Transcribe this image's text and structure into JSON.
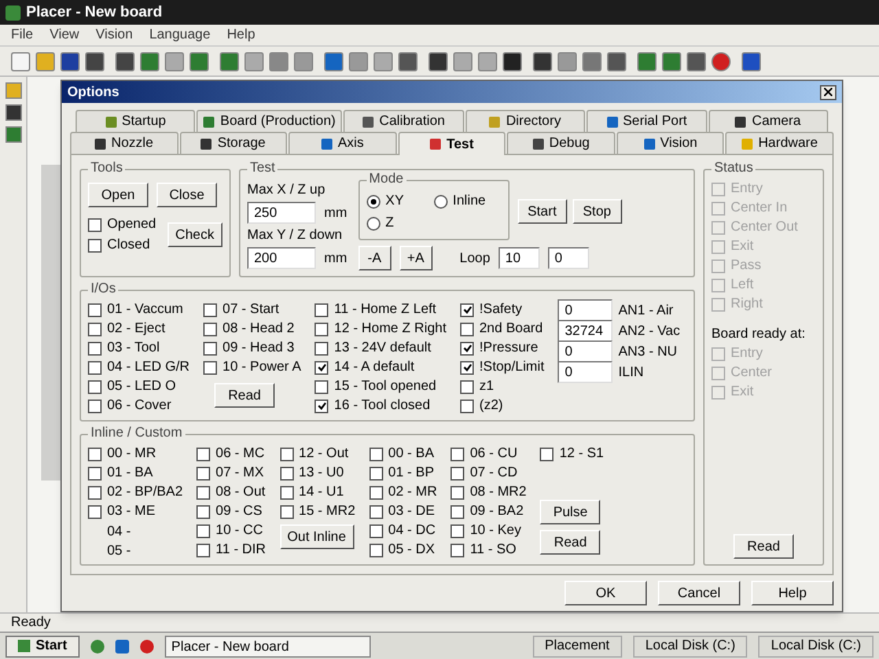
{
  "window": {
    "title": "Placer - New board"
  },
  "menu": [
    "File",
    "View",
    "Vision",
    "Language",
    "Help"
  ],
  "dialog": {
    "title": "Options",
    "tab_rows": [
      [
        {
          "label": "Startup",
          "selected": false
        },
        {
          "label": "Board (Production)",
          "selected": false
        },
        {
          "label": "Calibration",
          "selected": false
        },
        {
          "label": "Directory",
          "selected": false
        },
        {
          "label": "Serial Port",
          "selected": false
        },
        {
          "label": "Camera",
          "selected": false
        }
      ],
      [
        {
          "label": "Nozzle",
          "selected": false
        },
        {
          "label": "Storage",
          "selected": false
        },
        {
          "label": "Axis",
          "selected": false
        },
        {
          "label": "Test",
          "selected": true
        },
        {
          "label": "Debug",
          "selected": false
        },
        {
          "label": "Vision",
          "selected": false
        },
        {
          "label": "Hardware",
          "selected": false
        }
      ]
    ],
    "tools": {
      "title": "Tools",
      "buttons": [
        "Open",
        "Close"
      ],
      "checks": [
        {
          "label": "Opened",
          "checked": false
        },
        {
          "label": "Closed",
          "checked": false
        }
      ],
      "check_button": "Check"
    },
    "test": {
      "title": "Test",
      "up_label": "Max X / Z up",
      "up_value": "250",
      "up_unit": "mm",
      "down_label": "Max Y / Z down",
      "down_value": "200",
      "down_unit": "mm",
      "mode": {
        "title": "Mode",
        "options": [
          {
            "label": "XY",
            "selected": true
          },
          {
            "label": "Z",
            "selected": false
          },
          {
            "label": "Inline",
            "selected": false
          }
        ]
      },
      "start": "Start",
      "stop": "Stop",
      "minus": "-A",
      "plus": "+A",
      "loop_label": "Loop",
      "loop_value": "10",
      "count_value": "0"
    },
    "ios": {
      "title": "I/Os",
      "columns": [
        [
          {
            "label": "01 - Vaccum",
            "checked": false
          },
          {
            "label": "02 - Eject",
            "checked": false
          },
          {
            "label": "03 - Tool",
            "checked": false
          },
          {
            "label": "04 - LED G/R",
            "checked": false
          },
          {
            "label": "05 - LED O",
            "checked": false
          },
          {
            "label": "06 - Cover",
            "checked": false
          }
        ],
        [
          {
            "label": "07 - Start",
            "checked": false
          },
          {
            "label": "08 - Head 2",
            "checked": false
          },
          {
            "label": "09 - Head 3",
            "checked": false
          },
          {
            "label": "10 - Power A",
            "checked": false
          }
        ],
        [
          {
            "label": "11 - Home Z Left",
            "checked": false
          },
          {
            "label": "12 - Home Z Right",
            "checked": false
          },
          {
            "label": "13 - 24V default",
            "checked": false
          },
          {
            "label": "14 - A default",
            "checked": true
          },
          {
            "label": "15 - Tool opened",
            "checked": false
          },
          {
            "label": "16 - Tool closed",
            "checked": true
          }
        ],
        [
          {
            "label": "!Safety",
            "checked": true
          },
          {
            "label": "2nd Board",
            "checked": false
          },
          {
            "label": "!Pressure",
            "checked": true
          },
          {
            "label": "!Stop/Limit",
            "checked": true
          },
          {
            "label": "z1",
            "checked": false
          },
          {
            "label": "(z2)",
            "checked": false
          }
        ]
      ],
      "read": "Read",
      "analog": [
        {
          "value": "0",
          "label": "AN1 - Air"
        },
        {
          "value": "32724",
          "label": "AN2 - Vac"
        },
        {
          "value": "0",
          "label": "AN3 - NU"
        },
        {
          "value": "0",
          "label": "ILIN"
        }
      ]
    },
    "inline": {
      "title": "Inline / Custom",
      "columns": [
        [
          {
            "label": "00 - MR",
            "kind": "check",
            "checked": false
          },
          {
            "label": "01 - BA",
            "kind": "check",
            "checked": false
          },
          {
            "label": "02 - BP/BA2",
            "kind": "check",
            "checked": false
          },
          {
            "label": "03 - ME",
            "kind": "check",
            "checked": false
          },
          {
            "label": "04 -",
            "kind": "text"
          },
          {
            "label": "05 -",
            "kind": "text"
          }
        ],
        [
          {
            "label": "06 - MC",
            "kind": "check",
            "checked": false
          },
          {
            "label": "07 - MX",
            "kind": "check",
            "checked": false
          },
          {
            "label": "08 - Out",
            "kind": "check",
            "checked": false
          },
          {
            "label": "09 - CS",
            "kind": "check",
            "checked": false
          },
          {
            "label": "10 - CC",
            "kind": "check",
            "checked": false
          },
          {
            "label": "11 - DIR",
            "kind": "check",
            "checked": false
          }
        ],
        [
          {
            "label": "12 - Out",
            "kind": "check",
            "checked": false
          },
          {
            "label": "13 - U0",
            "kind": "check",
            "checked": false
          },
          {
            "label": "14 - U1",
            "kind": "check",
            "checked": false
          },
          {
            "label": "15 - MR2",
            "kind": "check",
            "checked": false
          }
        ],
        [
          {
            "label": "00 - BA",
            "kind": "check",
            "checked": false
          },
          {
            "label": "01 - BP",
            "kind": "check",
            "checked": false
          },
          {
            "label": "02 - MR",
            "kind": "check",
            "checked": false
          },
          {
            "label": "03 - DE",
            "kind": "check",
            "checked": false
          },
          {
            "label": "04 - DC",
            "kind": "check",
            "checked": false
          },
          {
            "label": "05 - DX",
            "kind": "check",
            "checked": false
          }
        ],
        [
          {
            "label": "06 - CU",
            "kind": "check",
            "checked": false
          },
          {
            "label": "07 - CD",
            "kind": "check",
            "checked": false
          },
          {
            "label": "08 - MR2",
            "kind": "check",
            "checked": false
          },
          {
            "label": "09 - BA2",
            "kind": "check",
            "checked": false
          },
          {
            "label": "10 - Key",
            "kind": "check",
            "checked": false
          },
          {
            "label": "11 - SO",
            "kind": "check",
            "checked": false
          }
        ],
        [
          {
            "label": "12 - S1",
            "kind": "check",
            "checked": false
          }
        ]
      ],
      "out_inline": "Out Inline",
      "pulse": "Pulse",
      "read": "Read"
    },
    "status": {
      "title": "Status",
      "checks": [
        {
          "label": "Entry",
          "checked": false,
          "disabled": true
        },
        {
          "label": "Center In",
          "checked": false,
          "disabled": true
        },
        {
          "label": "Center Out",
          "checked": false,
          "disabled": true
        },
        {
          "label": "Exit",
          "checked": false,
          "disabled": true
        },
        {
          "label": "Pass",
          "checked": false,
          "disabled": true
        },
        {
          "label": "Left",
          "checked": false,
          "disabled": true
        },
        {
          "label": "Right",
          "checked": false,
          "disabled": true
        }
      ],
      "ready_label": "Board ready at:",
      "ready_checks": [
        {
          "label": "Entry",
          "checked": false,
          "disabled": true
        },
        {
          "label": "Center",
          "checked": false,
          "disabled": true
        },
        {
          "label": "Exit",
          "checked": false,
          "disabled": true
        }
      ],
      "read": "Read"
    },
    "footer": [
      "OK",
      "Cancel",
      "Help"
    ]
  },
  "status_bar": "Ready",
  "taskbar": {
    "start": "Start",
    "tasks": [
      "Placer - New board"
    ],
    "tray": [
      "Placement",
      "Local Disk (C:)",
      "Local Disk (C:)"
    ]
  }
}
